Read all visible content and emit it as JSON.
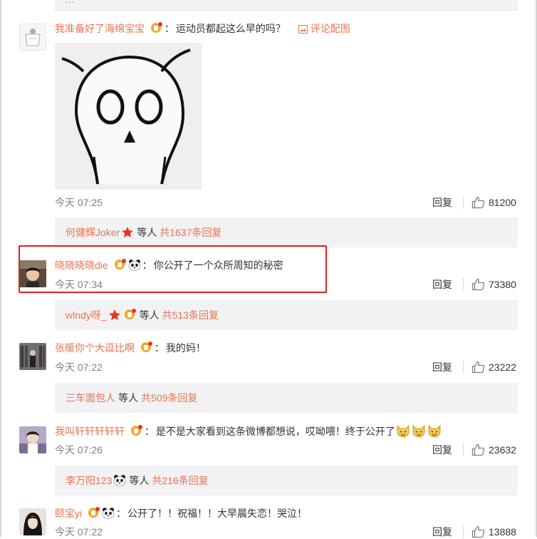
{
  "top_stub": {
    "text": "…"
  },
  "comments": [
    {
      "user": "我准备好了海绵宝宝",
      "text": "运动员都起这么早的吗？",
      "pic_link": "评论配图",
      "time": "今天 07:25",
      "reply_label": "回复",
      "likes": "81200",
      "thread": {
        "user": "何健辉Joker",
        "others": "等人",
        "total": "共1637条回复"
      }
    },
    {
      "user": "晓晓晓晓die",
      "text": "你公开了一个众所周知的秘密",
      "time": "今天 07:34",
      "reply_label": "回复",
      "likes": "73380",
      "thread": {
        "user": "wlndy呀_",
        "others": "等人",
        "total": "共513条回复"
      }
    },
    {
      "user": "张暖你个大逗比啊",
      "text": "我的妈！",
      "time": "今天 07:22",
      "reply_label": "回复",
      "likes": "23222",
      "thread": {
        "user": "三车面包人",
        "others": "等人",
        "total": "共509条回复"
      }
    },
    {
      "user": "我叫轩轩轩轩轩",
      "text": "是不是大家看到这条微博都想说，哎呦喂！终于公开了",
      "time": "今天 07:26",
      "reply_label": "回复",
      "likes": "23632",
      "thread": {
        "user": "李万阳123",
        "others": "等人",
        "total": "共216条回复"
      }
    },
    {
      "user": "颐宝yi",
      "text": "公开了！！祝福！！大早晨失恋！哭泣！",
      "time": "今天 07:22",
      "reply_label": "回复",
      "likes": "13888"
    }
  ],
  "colors": {
    "link": "#eb7350",
    "highlight": "#e02020",
    "reply_bg": "#f2f2f5"
  },
  "icons": [
    "image-icon",
    "thumbs-up-icon",
    "verified-badge-icon",
    "panda-emoji-icon",
    "star-badge-icon",
    "cat-emoji-icon"
  ]
}
